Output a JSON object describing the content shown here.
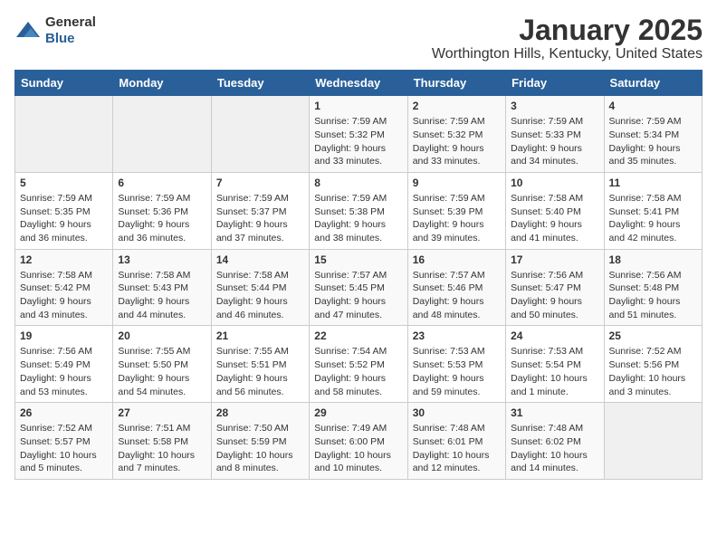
{
  "logo": {
    "general": "General",
    "blue": "Blue"
  },
  "title": "January 2025",
  "location": "Worthington Hills, Kentucky, United States",
  "weekdays": [
    "Sunday",
    "Monday",
    "Tuesday",
    "Wednesday",
    "Thursday",
    "Friday",
    "Saturday"
  ],
  "weeks": [
    [
      {
        "day": "",
        "info": ""
      },
      {
        "day": "",
        "info": ""
      },
      {
        "day": "",
        "info": ""
      },
      {
        "day": "1",
        "info": "Sunrise: 7:59 AM\nSunset: 5:32 PM\nDaylight: 9 hours\nand 33 minutes."
      },
      {
        "day": "2",
        "info": "Sunrise: 7:59 AM\nSunset: 5:32 PM\nDaylight: 9 hours\nand 33 minutes."
      },
      {
        "day": "3",
        "info": "Sunrise: 7:59 AM\nSunset: 5:33 PM\nDaylight: 9 hours\nand 34 minutes."
      },
      {
        "day": "4",
        "info": "Sunrise: 7:59 AM\nSunset: 5:34 PM\nDaylight: 9 hours\nand 35 minutes."
      }
    ],
    [
      {
        "day": "5",
        "info": "Sunrise: 7:59 AM\nSunset: 5:35 PM\nDaylight: 9 hours\nand 36 minutes."
      },
      {
        "day": "6",
        "info": "Sunrise: 7:59 AM\nSunset: 5:36 PM\nDaylight: 9 hours\nand 36 minutes."
      },
      {
        "day": "7",
        "info": "Sunrise: 7:59 AM\nSunset: 5:37 PM\nDaylight: 9 hours\nand 37 minutes."
      },
      {
        "day": "8",
        "info": "Sunrise: 7:59 AM\nSunset: 5:38 PM\nDaylight: 9 hours\nand 38 minutes."
      },
      {
        "day": "9",
        "info": "Sunrise: 7:59 AM\nSunset: 5:39 PM\nDaylight: 9 hours\nand 39 minutes."
      },
      {
        "day": "10",
        "info": "Sunrise: 7:58 AM\nSunset: 5:40 PM\nDaylight: 9 hours\nand 41 minutes."
      },
      {
        "day": "11",
        "info": "Sunrise: 7:58 AM\nSunset: 5:41 PM\nDaylight: 9 hours\nand 42 minutes."
      }
    ],
    [
      {
        "day": "12",
        "info": "Sunrise: 7:58 AM\nSunset: 5:42 PM\nDaylight: 9 hours\nand 43 minutes."
      },
      {
        "day": "13",
        "info": "Sunrise: 7:58 AM\nSunset: 5:43 PM\nDaylight: 9 hours\nand 44 minutes."
      },
      {
        "day": "14",
        "info": "Sunrise: 7:58 AM\nSunset: 5:44 PM\nDaylight: 9 hours\nand 46 minutes."
      },
      {
        "day": "15",
        "info": "Sunrise: 7:57 AM\nSunset: 5:45 PM\nDaylight: 9 hours\nand 47 minutes."
      },
      {
        "day": "16",
        "info": "Sunrise: 7:57 AM\nSunset: 5:46 PM\nDaylight: 9 hours\nand 48 minutes."
      },
      {
        "day": "17",
        "info": "Sunrise: 7:56 AM\nSunset: 5:47 PM\nDaylight: 9 hours\nand 50 minutes."
      },
      {
        "day": "18",
        "info": "Sunrise: 7:56 AM\nSunset: 5:48 PM\nDaylight: 9 hours\nand 51 minutes."
      }
    ],
    [
      {
        "day": "19",
        "info": "Sunrise: 7:56 AM\nSunset: 5:49 PM\nDaylight: 9 hours\nand 53 minutes."
      },
      {
        "day": "20",
        "info": "Sunrise: 7:55 AM\nSunset: 5:50 PM\nDaylight: 9 hours\nand 54 minutes."
      },
      {
        "day": "21",
        "info": "Sunrise: 7:55 AM\nSunset: 5:51 PM\nDaylight: 9 hours\nand 56 minutes."
      },
      {
        "day": "22",
        "info": "Sunrise: 7:54 AM\nSunset: 5:52 PM\nDaylight: 9 hours\nand 58 minutes."
      },
      {
        "day": "23",
        "info": "Sunrise: 7:53 AM\nSunset: 5:53 PM\nDaylight: 9 hours\nand 59 minutes."
      },
      {
        "day": "24",
        "info": "Sunrise: 7:53 AM\nSunset: 5:54 PM\nDaylight: 10 hours\nand 1 minute."
      },
      {
        "day": "25",
        "info": "Sunrise: 7:52 AM\nSunset: 5:56 PM\nDaylight: 10 hours\nand 3 minutes."
      }
    ],
    [
      {
        "day": "26",
        "info": "Sunrise: 7:52 AM\nSunset: 5:57 PM\nDaylight: 10 hours\nand 5 minutes."
      },
      {
        "day": "27",
        "info": "Sunrise: 7:51 AM\nSunset: 5:58 PM\nDaylight: 10 hours\nand 7 minutes."
      },
      {
        "day": "28",
        "info": "Sunrise: 7:50 AM\nSunset: 5:59 PM\nDaylight: 10 hours\nand 8 minutes."
      },
      {
        "day": "29",
        "info": "Sunrise: 7:49 AM\nSunset: 6:00 PM\nDaylight: 10 hours\nand 10 minutes."
      },
      {
        "day": "30",
        "info": "Sunrise: 7:48 AM\nSunset: 6:01 PM\nDaylight: 10 hours\nand 12 minutes."
      },
      {
        "day": "31",
        "info": "Sunrise: 7:48 AM\nSunset: 6:02 PM\nDaylight: 10 hours\nand 14 minutes."
      },
      {
        "day": "",
        "info": ""
      }
    ]
  ]
}
